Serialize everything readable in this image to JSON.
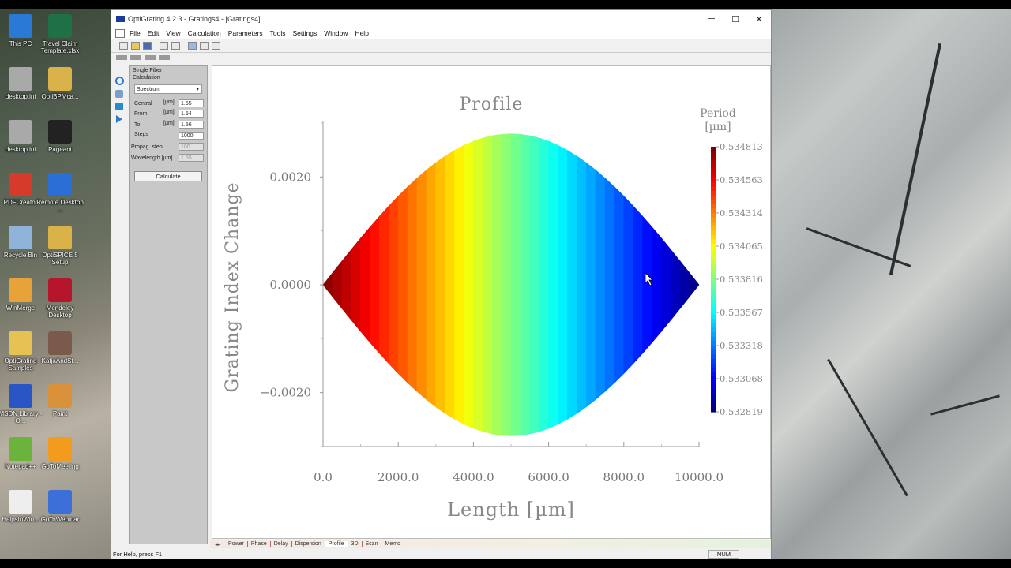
{
  "desktop": {
    "icons": [
      {
        "label": "This PC",
        "color": "#2b79d6"
      },
      {
        "label": "Travel Claim Template.xlsx",
        "color": "#1e7145"
      },
      {
        "label": "desktop.ini",
        "color": "#a9a9a9"
      },
      {
        "label": "OptiBPMca...",
        "color": "#d9b24a"
      },
      {
        "label": "desktop.ini",
        "color": "#a9a9a9"
      },
      {
        "label": "Pageant",
        "color": "#222222"
      },
      {
        "label": "PDFCreator",
        "color": "#d63a2a"
      },
      {
        "label": "Remote Desktop ...",
        "color": "#2a6fd6"
      },
      {
        "label": "Recycle Bin",
        "color": "#8fb3d9"
      },
      {
        "label": "OptiSPICE 5 Setup",
        "color": "#d9b24a"
      },
      {
        "label": "WinMerge",
        "color": "#e8a23a"
      },
      {
        "label": "Mendeley Desktop",
        "color": "#b5162b"
      },
      {
        "label": "OptiGrating Samples",
        "color": "#e6c255"
      },
      {
        "label": "KatjaAndSt...",
        "color": "#7a5a4a"
      },
      {
        "label": "MSDN Library - O...",
        "color": "#2a55c4"
      },
      {
        "label": "Paint",
        "color": "#d9913a"
      },
      {
        "label": "Notepad++",
        "color": "#6cb33e"
      },
      {
        "label": "GoToMeeting",
        "color": "#f29b1e"
      },
      {
        "label": "HelpsInWin...",
        "color": "#eeeeee"
      },
      {
        "label": "GoToWebinar",
        "color": "#3d6fd9"
      }
    ]
  },
  "window": {
    "title": "OptiGrating 4.2.3 - Gratings4 - [Gratings4]",
    "minimize": "─",
    "maximize": "☐",
    "close": "✕"
  },
  "menu": [
    "File",
    "Edit",
    "View",
    "Calculation",
    "Parameters",
    "Tools",
    "Settings",
    "Window",
    "Help"
  ],
  "panel": {
    "title_line1": "Single Fiber",
    "title_line2": "Calculation",
    "mode": "Spectrum",
    "central_label": "Central",
    "central_unit": "[µm]",
    "central_value": "1.55",
    "from_label": "From",
    "from_unit": "[µm]",
    "from_value": "1.54",
    "to_label": "To",
    "to_unit": "[µm]",
    "to_value": "1.56",
    "steps_label": "Steps",
    "steps_value": "1000",
    "propag_label": "Propag. step",
    "propag_value": "100",
    "wavelength_label": "Wavelength [µm]",
    "wavelength_value": "1.55",
    "calculate_label": "Calculate"
  },
  "tabs": [
    "Power",
    "Phase",
    "Delay",
    "Dispersion",
    "Profile",
    "3D",
    "Scan",
    "Memo"
  ],
  "active_tab": "Profile",
  "status": {
    "help": "For Help, press F1",
    "num": "NUM"
  },
  "chart_data": {
    "type": "heatmap",
    "title": "Profile",
    "xlabel": "Length [µm]",
    "ylabel": "Grating Index Change",
    "xlim": [
      0,
      10000
    ],
    "ylim": [
      -0.003,
      0.003
    ],
    "x_ticks": [
      "0.0",
      "2000.0",
      "4000.0",
      "6000.0",
      "8000.0",
      "10000.0"
    ],
    "y_ticks": [
      "0.0020",
      "0.0000",
      "−0.0020"
    ],
    "y_tick_values": [
      0.002,
      0.0,
      -0.002
    ],
    "envelope_amplitude": 0.0028,
    "envelope_shape": "half-sine from 0 to 10000 µm (mirrored about 0)",
    "colorbar": {
      "title_line1": "Period",
      "title_line2": "[µm]",
      "ticks": [
        "0.534813",
        "0.534563",
        "0.534314",
        "0.534065",
        "0.533816",
        "0.533567",
        "0.533318",
        "0.533068",
        "0.532819"
      ],
      "min": 0.532819,
      "max": 0.534813,
      "colormap": "jet",
      "direction": "period decreases linearly from left (max) to right (min)"
    }
  }
}
